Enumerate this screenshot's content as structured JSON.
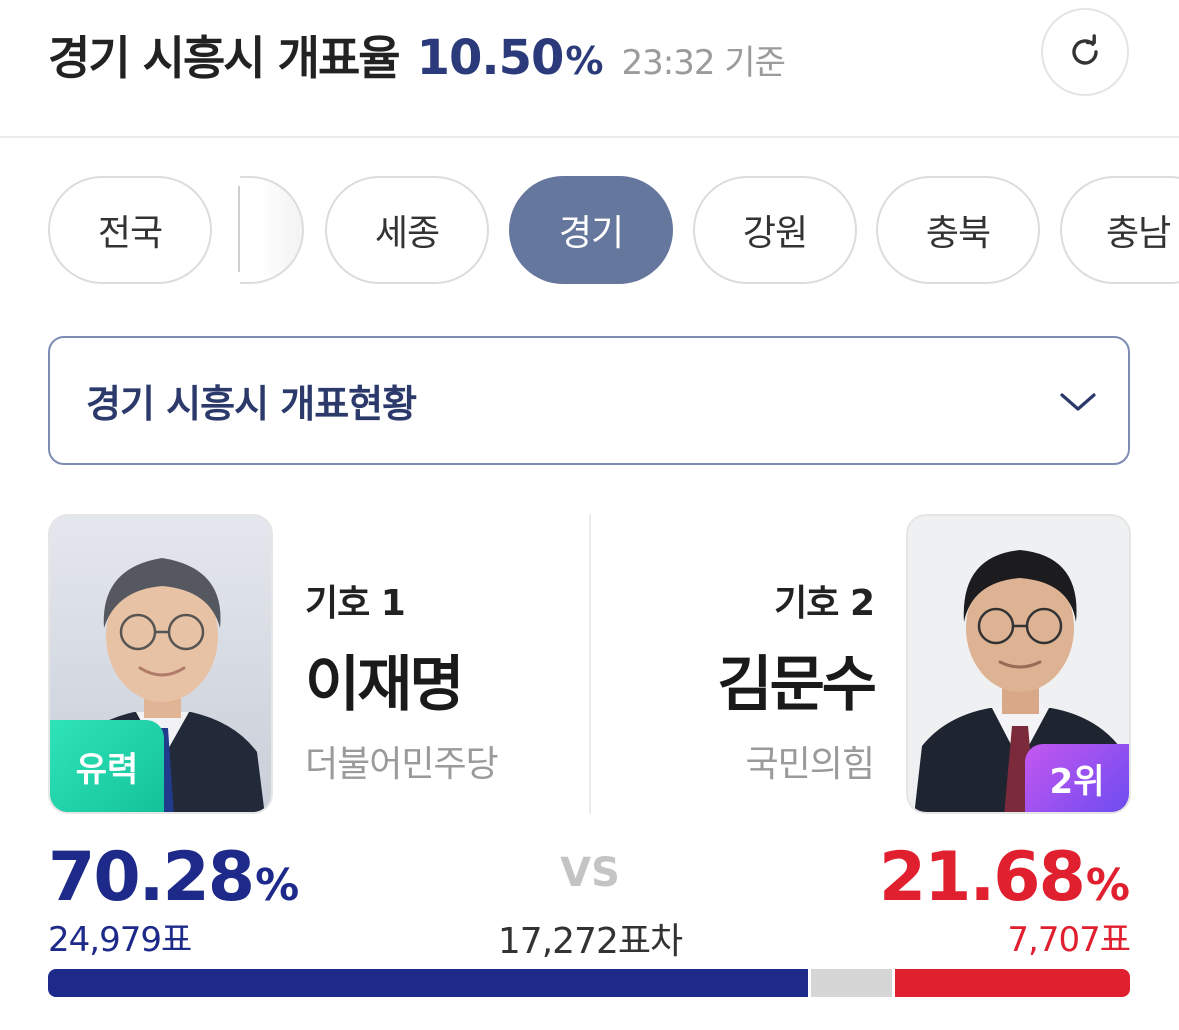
{
  "header": {
    "region": "경기 시흥시 개표율",
    "rate_value": "10.50",
    "rate_unit": "%",
    "time": "23:32 기준",
    "refresh_icon": "refresh-icon"
  },
  "tabs": [
    {
      "label": "전국",
      "active": false
    },
    {
      "label": "세종",
      "active": false
    },
    {
      "label": "경기",
      "active": true
    },
    {
      "label": "강원",
      "active": false
    },
    {
      "label": "충북",
      "active": false
    },
    {
      "label": "충남",
      "active": false
    }
  ],
  "dropdown": {
    "label": "경기 시흥시 개표현황",
    "icon": "chevron-down-icon"
  },
  "candidates": {
    "left": {
      "number": "기호 1",
      "name": "이재명",
      "party": "더불어민주당",
      "badge": "유력",
      "percent": "70.28",
      "percent_unit": "%",
      "votes": "24,979표",
      "share": 0.7028
    },
    "right": {
      "number": "기호 2",
      "name": "김문수",
      "party": "국민의힘",
      "badge": "2위",
      "percent": "21.68",
      "percent_unit": "%",
      "votes": "7,707표",
      "share": 0.2168
    }
  },
  "versus": {
    "label": "VS",
    "difference": "17,272표차"
  },
  "colors": {
    "blue": "#1d2a8a",
    "red": "#e0202f",
    "active_tab": "#66779e"
  }
}
